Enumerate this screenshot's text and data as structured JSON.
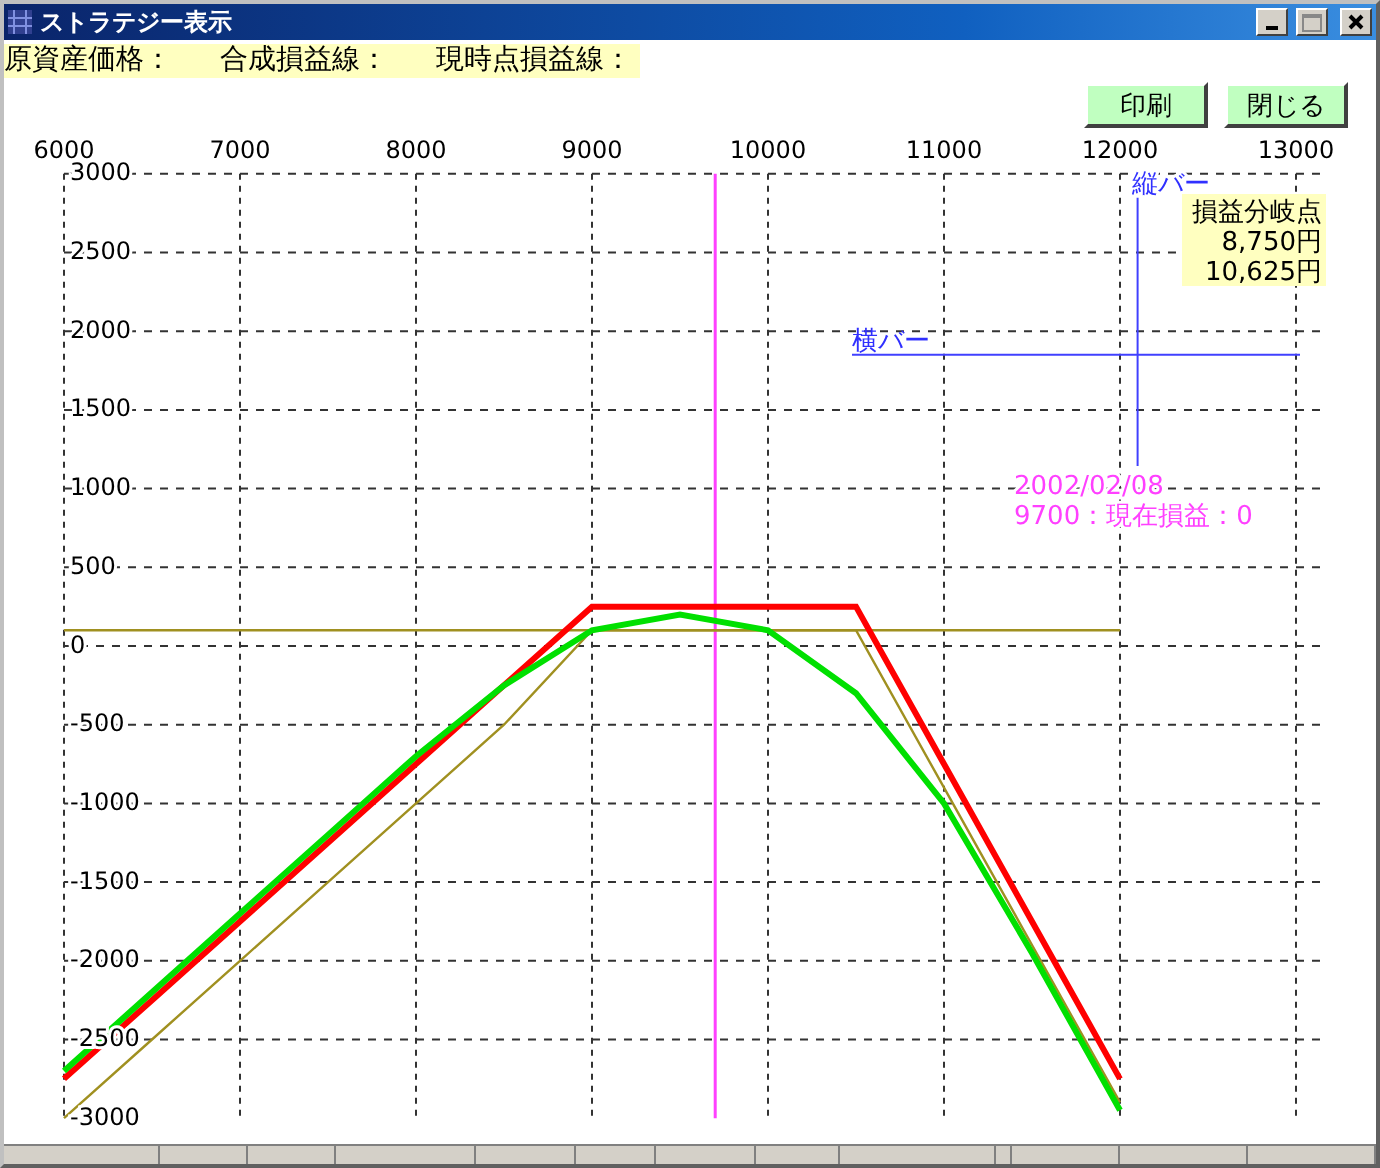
{
  "window": {
    "title": "ストラテジー表示"
  },
  "info_labels": [
    "原資産価格：",
    "合成損益線：",
    "現時点損益線："
  ],
  "buttons": [
    "印刷",
    "閉じる"
  ],
  "chart": {
    "chart_data": {
      "type": "line",
      "grid": true,
      "x": [
        6000,
        6500,
        7000,
        7500,
        8000,
        8500,
        9000,
        9500,
        10000,
        10500,
        11000,
        11500,
        12000
      ],
      "series": [
        {
          "color": "#a09020",
          "values": [
            100,
            100,
            100,
            100,
            100,
            100,
            100,
            100,
            100,
            100,
            100,
            100,
            100
          ]
        },
        {
          "color": "#a09020",
          "values": [
            -3000,
            -2500,
            -2000,
            -1500,
            -1000,
            -500,
            100,
            100,
            100,
            100,
            -900,
            -1900,
            -2900
          ]
        },
        {
          "color": "#ff0000",
          "values": [
            -2750,
            -2250,
            -1750,
            -1250,
            -750,
            -250,
            250,
            250,
            250,
            250,
            -750,
            -1750,
            -2750
          ]
        },
        {
          "color": "#00e000",
          "values": [
            -2700,
            -2200,
            -1700,
            -1200,
            -700,
            -250,
            100,
            200,
            100,
            -300,
            -1000,
            -1950,
            -2950
          ]
        }
      ],
      "xlim": [
        6000,
        13000
      ],
      "ylim": [
        -3000,
        3000
      ],
      "xticks": [
        6000,
        7000,
        8000,
        9000,
        10000,
        11000,
        12000,
        13000
      ],
      "yticks": [
        -3000,
        -2500,
        -2000,
        -1500,
        -1000,
        -500,
        0,
        500,
        1000,
        1500,
        2000,
        2500,
        3000
      ],
      "ref_lines": [
        {
          "axis": "x",
          "value": 9700,
          "color": "#ff40ff"
        },
        {
          "axis": "x",
          "value": 12100,
          "color": "#4040ff"
        },
        {
          "axis": "y",
          "value": 1850,
          "color": "#4040ff"
        }
      ]
    },
    "cursor": {
      "date": "2002/02/08",
      "reading": "9700：現在損益：0"
    },
    "vertical_bar": {
      "label": "縦バー"
    },
    "horizontal_bar": {
      "label": "横バー"
    },
    "breakeven": {
      "title": "損益分岐点",
      "values": [
        "8,750円",
        "10,625円"
      ]
    }
  }
}
